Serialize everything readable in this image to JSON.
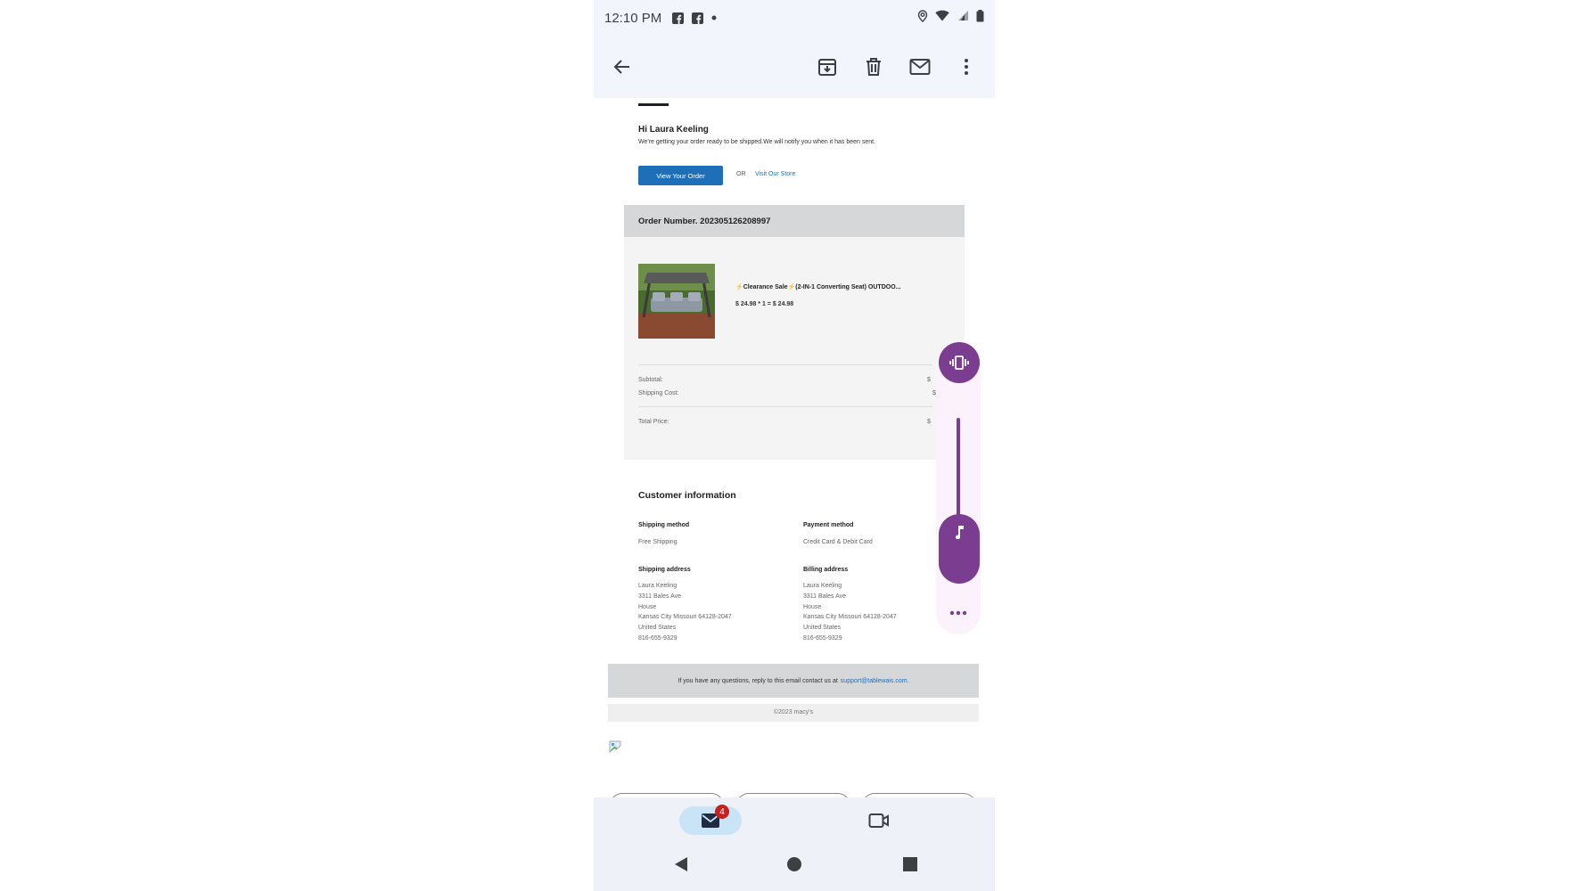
{
  "status_bar": {
    "time": "12:10 PM"
  },
  "email": {
    "greeting": "Hi Laura Keeling",
    "greeting_sub": "We're getting your order ready to be shipped.We will notify you when it has been sent.",
    "view_order_label": "View Your Order",
    "or_label": "OR",
    "visit_store_label": "Visit Our Store",
    "order_number": "Order Number. 202305126208997",
    "product": {
      "title": "⚡Clearance Sale⚡(2-IN-1 Converting Seat) OUTDOO...",
      "price_line": "$ 24.98 * 1 = $ 24.98"
    },
    "summary": {
      "subtotal_label": "Subtotal:",
      "subtotal_value": "$",
      "shipping_label": "Shipping Cost:",
      "shipping_value": "$",
      "total_label": "Total Price:",
      "total_value": "$"
    },
    "customer": {
      "title": "Customer information",
      "shipping_method_label": "Shipping method",
      "shipping_method_value": "Free Shipping",
      "payment_method_label": "Payment method",
      "payment_method_value": "Credit Card & Debit Card",
      "shipping_address_label": "Shipping address",
      "shipping_address_lines": [
        "Laura Keeling",
        "3311 Bales Ave",
        "House",
        "Kansas City Missouri 64128-2047",
        "United States",
        "816-655-9329"
      ],
      "billing_address_label": "Billing address",
      "billing_address_lines": [
        "Laura Keeling",
        "3311 Bales Ave",
        "House",
        "Kansas City Missouri 64128-2047",
        "United States",
        "816-655-9329"
      ]
    },
    "footer_text": "If you have any questions, reply to this email contact us at",
    "footer_link": "support@tablewais.com.",
    "copyright": "©2023 macy's"
  },
  "bottom_nav": {
    "mail_badge": "4"
  },
  "colors": {
    "accent": "#1f6fb8",
    "volume": "#7a3d8f",
    "badge": "#c5221f"
  }
}
